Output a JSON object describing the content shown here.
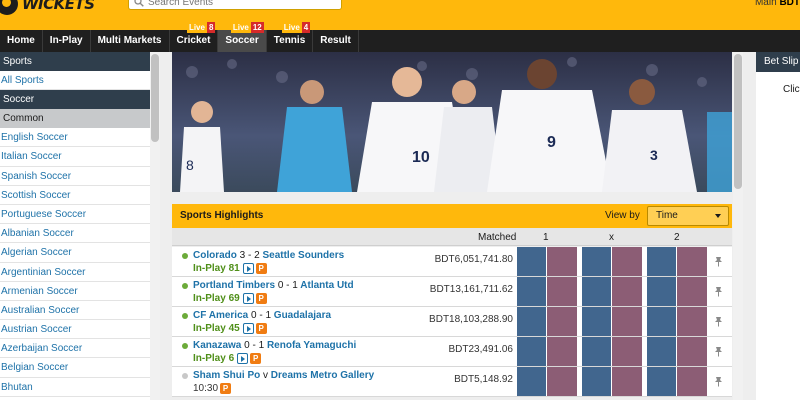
{
  "header": {
    "logo_text": "WICKETS",
    "search_placeholder": "Search Events",
    "account_label": "Main",
    "account_currency": "BDT"
  },
  "nav": {
    "items": [
      {
        "label": "Home"
      },
      {
        "label": "In-Play"
      },
      {
        "label": "Multi Markets"
      },
      {
        "label": "Cricket",
        "badge_live": "Live",
        "badge_count": "8"
      },
      {
        "label": "Soccer",
        "badge_live": "Live",
        "badge_count": "12"
      },
      {
        "label": "Tennis",
        "badge_live": "Live",
        "badge_count": "4"
      },
      {
        "label": "Result"
      }
    ]
  },
  "sidebar": {
    "sports_heading": "Sports",
    "all_sports": "All Sports",
    "soccer_heading": "Soccer",
    "common_label": "Common",
    "links": [
      "English Soccer",
      "Italian Soccer",
      "Spanish Soccer",
      "Scottish Soccer",
      "Portuguese Soccer",
      "Albanian Soccer",
      "Algerian Soccer",
      "Argentinian Soccer",
      "Armenian Soccer",
      "Australian Soccer",
      "Austrian Soccer",
      "Azerbaijan Soccer",
      "Belgian Soccer",
      "Bhutan"
    ]
  },
  "highlights": {
    "title": "Sports Highlights",
    "view_by_label": "View by",
    "view_by_value": "Time",
    "col_matched": "Matched",
    "col_1": "1",
    "col_x": "x",
    "col_2": "2"
  },
  "events": [
    {
      "home": "Colorado",
      "score": "3 - 2",
      "away": "Seattle Sounders",
      "status": "In-Play 81",
      "live": true,
      "matched": "BDT6,051,741.80",
      "streaming": true
    },
    {
      "home": "Portland Timbers",
      "score": "0 - 1",
      "away": "Atlanta Utd",
      "status": "In-Play 69",
      "live": true,
      "matched": "BDT13,161,711.62",
      "streaming": true
    },
    {
      "home": "CF America",
      "score": "0 - 1",
      "away": "Guadalajara",
      "status": "In-Play 45",
      "live": true,
      "matched": "BDT18,103,288.90",
      "streaming": true
    },
    {
      "home": "Kanazawa",
      "score": "0 - 1",
      "away": "Renofa Yamaguchi",
      "status": "In-Play 6",
      "live": true,
      "matched": "BDT23,491.06",
      "streaming": true
    },
    {
      "home": "Sham Shui Po",
      "score": "v",
      "away": "Dreams Metro Gallery",
      "status": "10:30",
      "live": false,
      "matched": "BDT5,148.92",
      "streaming": false
    }
  ],
  "betslip": {
    "title": "Bet Slip",
    "hint": "Click"
  },
  "banner": {
    "jersey_numbers": [
      "8",
      "10",
      "9",
      "3"
    ]
  },
  "colors": {
    "brand_yellow": "#ffb80c",
    "nav_dark": "#1f1f1f",
    "back_blue": "#41668e",
    "lay_pink": "#8c5d75",
    "link_blue": "#1e72a8",
    "live_green": "#6cab3a"
  }
}
